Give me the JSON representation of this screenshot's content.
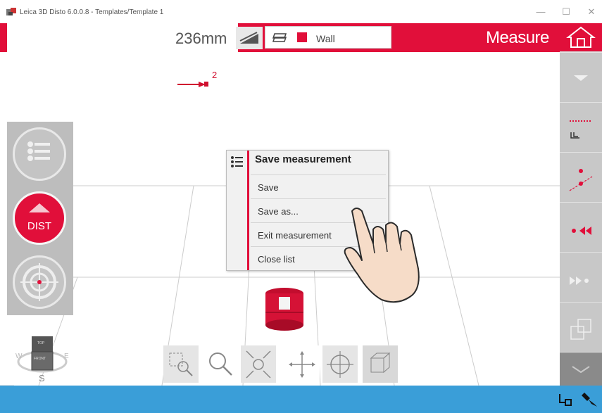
{
  "window": {
    "title": "Leica 3D Disto 6.0.0.8 - Templates/Template 1",
    "controls": [
      "—",
      "☐",
      "✕"
    ]
  },
  "header": {
    "measurement": "236mm",
    "layer": "Wall",
    "mode": "Measure",
    "accent_color": "#e10f3a"
  },
  "viewport": {
    "point_label": "2"
  },
  "left_toolbar": {
    "dist_label": "DIST"
  },
  "context_menu": {
    "title": "Save measurement",
    "items": [
      "Save",
      "Save as...",
      "Exit measurement",
      "Close list"
    ]
  },
  "compass": {
    "west": "W",
    "east": "E",
    "south": "S",
    "cube_top": "TOP",
    "cube_front": "FRONT"
  },
  "status_bar": {
    "color": "#3a9ed8"
  },
  "icons": [
    "home-icon",
    "chevron-down-icon",
    "slope-icon",
    "layer-icon",
    "list-icon",
    "target-icon",
    "select-zoom-icon",
    "zoom-icon",
    "zoom-extents-icon",
    "pan-icon",
    "orbit-icon",
    "view-cube-icon",
    "power-plug-icon",
    "laser-pointer-icon",
    "hand-pointer-icon"
  ]
}
